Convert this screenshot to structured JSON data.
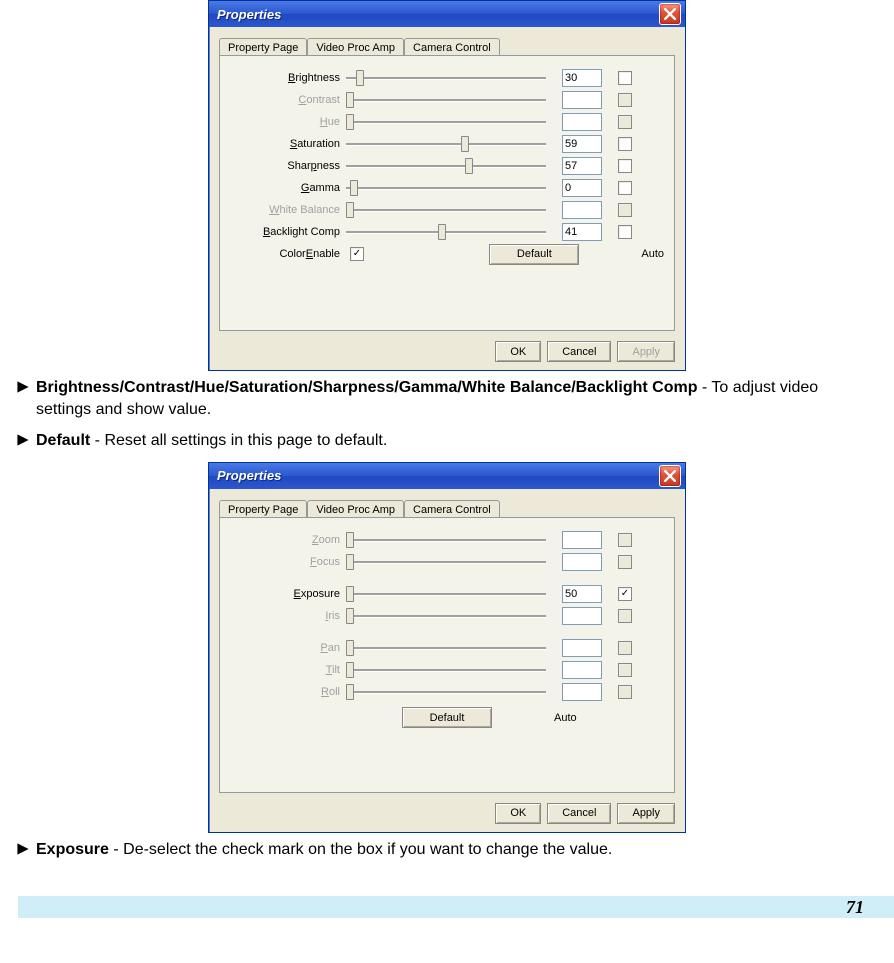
{
  "dialog1": {
    "title": "Properties",
    "tabs": [
      "Property Page",
      "Video Proc Amp",
      "Camera Control"
    ],
    "activeTabIndex": 1,
    "rows": [
      {
        "label_pre": "",
        "u": "B",
        "label_post": "rightness",
        "disabled": false,
        "thumbPct": 5,
        "value": "30",
        "hasValue": true,
        "autoState": "enabled"
      },
      {
        "label_pre": "",
        "u": "C",
        "label_post": "ontrast",
        "disabled": true,
        "thumbPct": 0,
        "value": "",
        "hasValue": true,
        "autoState": "disabled"
      },
      {
        "label_pre": "",
        "u": "H",
        "label_post": "ue",
        "disabled": true,
        "thumbPct": 0,
        "value": "",
        "hasValue": true,
        "autoState": "disabled"
      },
      {
        "label_pre": "",
        "u": "S",
        "label_post": "aturation",
        "disabled": false,
        "thumbPct": 60,
        "value": "59",
        "hasValue": true,
        "autoState": "enabled"
      },
      {
        "label_pre": "Shar",
        "u": "p",
        "label_post": "ness",
        "disabled": false,
        "thumbPct": 62,
        "value": "57",
        "hasValue": true,
        "autoState": "enabled"
      },
      {
        "label_pre": "",
        "u": "G",
        "label_post": "amma",
        "disabled": false,
        "thumbPct": 2,
        "value": "0",
        "hasValue": true,
        "autoState": "enabled"
      },
      {
        "label_pre": "",
        "u": "W",
        "label_post": "hite Balance",
        "disabled": true,
        "thumbPct": 0,
        "value": "",
        "hasValue": true,
        "autoState": "disabled"
      },
      {
        "label_pre": "",
        "u": "B",
        "label_post": "acklight Comp",
        "disabled": false,
        "thumbPct": 48,
        "value": "41",
        "hasValue": true,
        "autoState": "enabled"
      }
    ],
    "colorEnable": {
      "label_pre": "Color",
      "u": "E",
      "label_post": "nable",
      "checked": true
    },
    "defaultBtn": {
      "u": "D",
      "rest": "efault"
    },
    "autoHeader": "Auto",
    "buttons": {
      "ok": "OK",
      "cancel": "Cancel",
      "apply": {
        "u": "A",
        "rest": "pply"
      },
      "applyDisabled": true
    }
  },
  "bullet1": {
    "bold": "Brightness/Contrast/Hue/Saturation/Sharpness/Gamma/White Balance/Backlight Comp",
    "rest": " - To adjust video settings and show value."
  },
  "bullet2": {
    "bold": "Default",
    "rest": " - Reset all settings in this page to default."
  },
  "dialog2": {
    "title": "Properties",
    "tabs": [
      "Property Page",
      "Video Proc Amp",
      "Camera Control"
    ],
    "activeTabIndex": 2,
    "rows": [
      {
        "label_pre": "",
        "u": "Z",
        "label_post": "oom",
        "disabled": true,
        "thumbPct": 0,
        "value": "",
        "hasValue": true,
        "autoState": "disabled"
      },
      {
        "label_pre": "",
        "u": "F",
        "label_post": "ocus",
        "disabled": true,
        "thumbPct": 0,
        "value": "",
        "hasValue": true,
        "autoState": "disabled"
      }
    ],
    "rows2": [
      {
        "label_pre": "",
        "u": "E",
        "label_post": "xposure",
        "disabled": false,
        "thumbPct": 0,
        "value": "50",
        "hasValue": true,
        "autoState": "checked"
      },
      {
        "label_pre": "",
        "u": "I",
        "label_post": "ris",
        "disabled": true,
        "thumbPct": 0,
        "value": "",
        "hasValue": true,
        "autoState": "disabled"
      }
    ],
    "rows3": [
      {
        "label_pre": "",
        "u": "P",
        "label_post": "an",
        "disabled": true,
        "thumbPct": 0,
        "value": "",
        "hasValue": true,
        "autoState": "disabled"
      },
      {
        "label_pre": "",
        "u": "T",
        "label_post": "ilt",
        "disabled": true,
        "thumbPct": 0,
        "value": "",
        "hasValue": true,
        "autoState": "disabled"
      },
      {
        "label_pre": "",
        "u": "R",
        "label_post": "oll",
        "disabled": true,
        "thumbPct": 0,
        "value": "",
        "hasValue": true,
        "autoState": "disabled"
      }
    ],
    "defaultBtn": {
      "u": "D",
      "rest": "efault"
    },
    "autoHeader": "Auto",
    "buttons": {
      "ok": "OK",
      "cancel": "Cancel",
      "apply": {
        "u": "A",
        "rest": "pply"
      },
      "applyDisabled": false
    }
  },
  "bullet3": {
    "bold": "Exposure",
    "rest": " - De-select the check mark on the box if you want to change the value."
  },
  "pageNumber": "71"
}
